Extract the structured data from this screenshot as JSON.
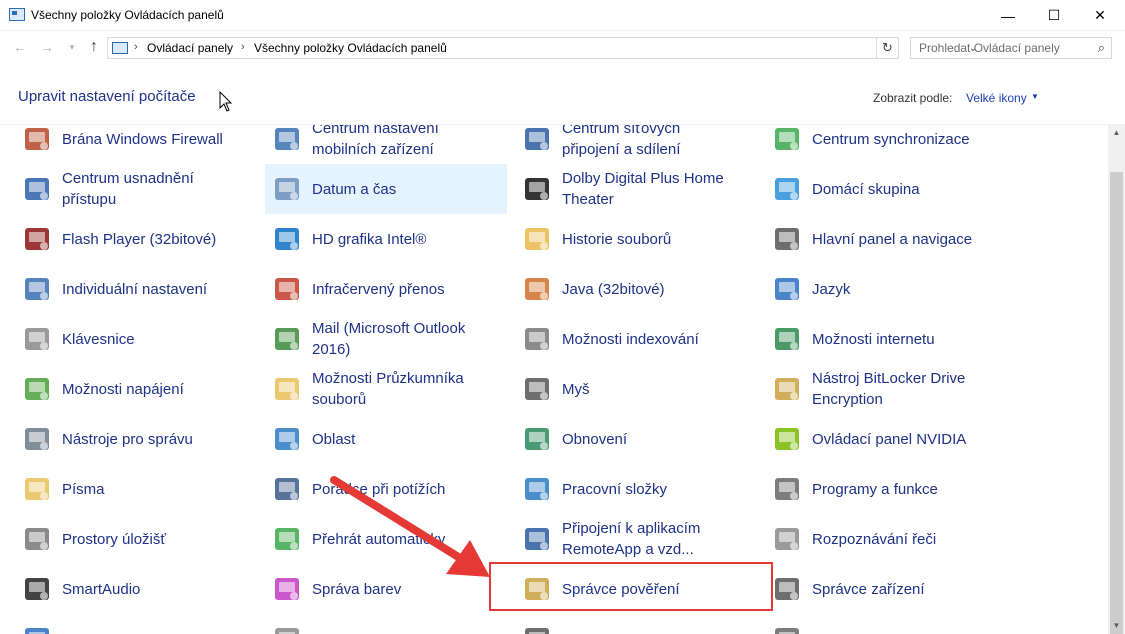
{
  "window": {
    "title": "Všechny položky Ovládacích panelů",
    "min_glyph": "—",
    "max_glyph": "☐",
    "close_glyph": "✕"
  },
  "nav": {
    "back_glyph": "←",
    "forward_glyph": "→",
    "recent_glyph": "▾",
    "up_glyph": "↑",
    "breadcrumb": [
      "Ovládací panely",
      "Všechny položky Ovládacích panelů"
    ],
    "crumb_separator": "›",
    "dropdown_glyph": "⌄",
    "refresh_glyph": "↻",
    "search_placeholder": "Prohledat Ovládací panely",
    "search_glyph": "⌕"
  },
  "header": {
    "title": "Upravit nastavení počítače",
    "view_label": "Zobrazit podle:",
    "view_value": "Velké ikony",
    "view_caret": "▼"
  },
  "items": [
    {
      "label": [
        "Brána Windows Firewall"
      ],
      "icon": "firewall-icon",
      "color": "#b5462a"
    },
    {
      "label": [
        "Centrum nastavení",
        "mobilních zařízení"
      ],
      "icon": "mobility-center-icon",
      "color": "#3a6fb0"
    },
    {
      "label": [
        "Centrum síťových",
        "připojení a sdílení"
      ],
      "icon": "network-center-icon",
      "color": "#2c5aa0"
    },
    {
      "label": [
        "Centrum synchronizace"
      ],
      "icon": "sync-center-icon",
      "color": "#3aa84a"
    },
    {
      "label": [
        "Centrum usnadnění",
        "přístupu"
      ],
      "icon": "ease-of-access-icon",
      "color": "#2a5fa8"
    },
    {
      "label": [
        "Datum a čas"
      ],
      "icon": "date-time-icon",
      "color": "#6a8fb8",
      "highlight": true
    },
    {
      "label": [
        "Dolby Digital Plus Home",
        "Theater"
      ],
      "icon": "dolby-icon",
      "color": "#111111"
    },
    {
      "label": [
        "Domácí skupina"
      ],
      "icon": "homegroup-icon",
      "color": "#2a8fd8"
    },
    {
      "label": [
        "Flash Player (32bitové)"
      ],
      "icon": "flash-icon",
      "color": "#8a1414"
    },
    {
      "label": [
        "HD grafika Intel®"
      ],
      "icon": "intel-graphics-icon",
      "color": "#0a6fc2"
    },
    {
      "label": [
        "Historie souborů"
      ],
      "icon": "file-history-icon",
      "color": "#e8b84a"
    },
    {
      "label": [
        "Hlavní panel a navigace"
      ],
      "icon": "taskbar-icon",
      "color": "#555555"
    },
    {
      "label": [
        "Individuální nastavení"
      ],
      "icon": "personalization-icon",
      "color": "#3a6fb0"
    },
    {
      "label": [
        "Infračervený přenos"
      ],
      "icon": "infrared-icon",
      "color": "#c23a2a"
    },
    {
      "label": [
        "Java (32bitové)"
      ],
      "icon": "java-icon",
      "color": "#d0702a"
    },
    {
      "label": [
        "Jazyk"
      ],
      "icon": "language-icon",
      "color": "#2a6fc2"
    },
    {
      "label": [
        "Klávesnice"
      ],
      "icon": "keyboard-icon",
      "color": "#888888"
    },
    {
      "label": [
        "Mail (Microsoft Outlook",
        "2016)"
      ],
      "icon": "mail-icon",
      "color": "#3a8a3a"
    },
    {
      "label": [
        "Možnosti indexování"
      ],
      "icon": "indexing-icon",
      "color": "#777777"
    },
    {
      "label": [
        "Možnosti internetu"
      ],
      "icon": "internet-options-icon",
      "color": "#2a8a4a"
    },
    {
      "label": [
        "Možnosti napájení"
      ],
      "icon": "power-options-icon",
      "color": "#4aa03a"
    },
    {
      "label": [
        "Možnosti Průzkumníka",
        "souborů"
      ],
      "icon": "explorer-options-icon",
      "color": "#e8c05a"
    },
    {
      "label": [
        "Myš"
      ],
      "icon": "mouse-icon",
      "color": "#555555"
    },
    {
      "label": [
        "Nástroj BitLocker Drive",
        "Encryption"
      ],
      "icon": "bitlocker-icon",
      "color": "#c8a040"
    },
    {
      "label": [
        "Nástroje pro správu"
      ],
      "icon": "admin-tools-icon",
      "color": "#6a7a8a"
    },
    {
      "label": [
        "Oblast"
      ],
      "icon": "region-icon",
      "color": "#2a7ac2"
    },
    {
      "label": [
        "Obnovení"
      ],
      "icon": "recovery-icon",
      "color": "#2a8a5a"
    },
    {
      "label": [
        "Ovládací panel NVIDIA"
      ],
      "icon": "nvidia-icon",
      "color": "#76b900"
    },
    {
      "label": [
        "Písma"
      ],
      "icon": "fonts-icon",
      "color": "#e8c05a"
    },
    {
      "label": [
        "Poradce při potížích"
      ],
      "icon": "troubleshooting-icon",
      "color": "#3a5a8a"
    },
    {
      "label": [
        "Pracovní složky"
      ],
      "icon": "work-folders-icon",
      "color": "#2a7ac2"
    },
    {
      "label": [
        "Programy a funkce"
      ],
      "icon": "programs-icon",
      "color": "#666666"
    },
    {
      "label": [
        "Prostory úložišť"
      ],
      "icon": "storage-spaces-icon",
      "color": "#777777"
    },
    {
      "label": [
        "Přehrát automaticky"
      ],
      "icon": "autoplay-icon",
      "color": "#3aa84a"
    },
    {
      "label": [
        "Připojení k aplikacím",
        "RemoteApp a vzd..."
      ],
      "icon": "remoteapp-icon",
      "color": "#2a5aa0"
    },
    {
      "label": [
        "Rozpoznávání řeči"
      ],
      "icon": "speech-icon",
      "color": "#888888"
    },
    {
      "label": [
        "SmartAudio"
      ],
      "icon": "smartaudio-icon",
      "color": "#222222"
    },
    {
      "label": [
        "Správa barev"
      ],
      "icon": "color-management-icon",
      "color": "#c23ac2"
    },
    {
      "label": [
        "Správce pověření"
      ],
      "icon": "credential-manager-icon",
      "color": "#c8a040"
    },
    {
      "label": [
        "Správce zařízení"
      ],
      "icon": "device-manager-icon",
      "color": "#555555"
    },
    {
      "label": [
        ""
      ],
      "icon": "partial-icon",
      "color": "#2a6fc2"
    },
    {
      "label": [
        ""
      ],
      "icon": "partial-icon",
      "color": "#888888"
    },
    {
      "label": [
        ""
      ],
      "icon": "partial-icon",
      "color": "#555555"
    },
    {
      "label": [
        ""
      ],
      "icon": "partial-icon",
      "color": "#666666"
    }
  ],
  "annotation": {
    "arrow_color": "#e53935",
    "box_color": "#e53935"
  }
}
